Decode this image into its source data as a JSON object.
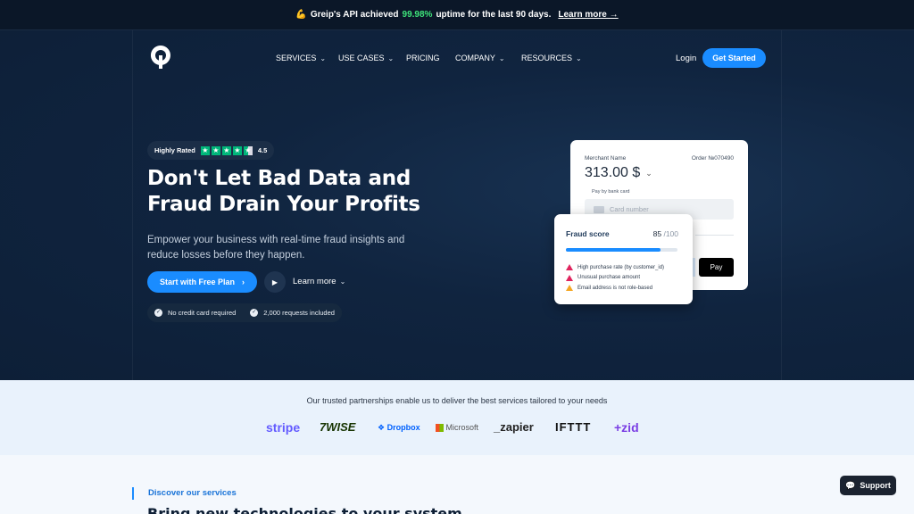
{
  "announcement": {
    "emoji": "💪",
    "prefix": "Greip's API achieved",
    "highlight": "99.98%",
    "suffix": "uptime for the last 90 days.",
    "link": "Learn more →"
  },
  "nav": {
    "items": [
      {
        "label": "SERVICES",
        "dropdown": true
      },
      {
        "label": "USE CASES",
        "dropdown": true
      },
      {
        "label": "PRICING",
        "dropdown": false
      },
      {
        "label": "COMPANY",
        "dropdown": true
      },
      {
        "label": "RESOURCES",
        "dropdown": true
      }
    ],
    "login": "Login",
    "get_started": "Get Started"
  },
  "hero": {
    "rating_label": "Highly Rated",
    "rating_value": "4.5",
    "rating_stars": 4.5,
    "headline": "Don't Let Bad Data and Fraud Drain Your Profits",
    "subtitle": "Empower your business with real-time fraud insights and reduce losses before they happen.",
    "cta": "Start with Free Plan",
    "learn_more": "Learn more",
    "checks": [
      "No credit card required",
      "2,000 requests included"
    ]
  },
  "merchant_card": {
    "merchant_name": "Merchant Name",
    "order": "Order №070490",
    "amount": "313.00 $",
    "pay_label": "Pay by bank card",
    "card_placeholder": "Card number",
    "apple_pay": " Pay"
  },
  "fraud_card": {
    "title": "Fraud score",
    "score": "85",
    "max": "/100",
    "score_fraction": 0.85,
    "alerts": [
      {
        "text": "High purchase rate (by customer_id)",
        "level": "high"
      },
      {
        "text": "Unusual purchase amount",
        "level": "high"
      },
      {
        "text": "Email address is not role-based",
        "level": "medium"
      }
    ]
  },
  "partners": {
    "title": "Our trusted partnerships enable us to deliver the best services tailored to your needs",
    "logos": [
      "stripe",
      "7WISE",
      "Dropbox",
      "Microsoft",
      "_zapier",
      "IFTTT",
      "+zid"
    ]
  },
  "services": {
    "eyebrow": "Discover our services",
    "heading": "Bring new technologies to your system"
  },
  "support": {
    "label": "Support"
  },
  "colors": {
    "accent": "#1a8cff",
    "hero_bg": "#10243f",
    "trustpilot": "#00b67a",
    "uptime": "#3ee37a"
  }
}
